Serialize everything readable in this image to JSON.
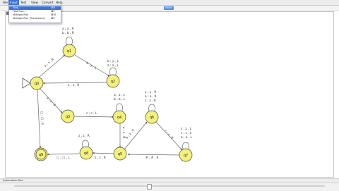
{
  "menubar": {
    "items": [
      "File",
      "Input",
      "Test",
      "View",
      "Convert",
      "Help"
    ]
  },
  "mode_badge": "Editor",
  "input_menu": {
    "items": [
      {
        "label": "Step...",
        "shortcut": "⌘R"
      },
      {
        "label": "Fast Run...",
        "shortcut": "⌘T"
      },
      {
        "label": "Multiple Run",
        "shortcut": "⌘M"
      },
      {
        "label": "Multiple Run (Transducer)",
        "shortcut": "⌘T"
      }
    ]
  },
  "automaton": {
    "states": [
      {
        "id": "q0",
        "label": "q0",
        "initial": true,
        "final": false
      },
      {
        "id": "q1",
        "label": "q1",
        "initial": false,
        "final": false
      },
      {
        "id": "q2",
        "label": "q2",
        "initial": false,
        "final": false
      },
      {
        "id": "q3",
        "label": "q3",
        "initial": false,
        "final": false
      },
      {
        "id": "q4",
        "label": "q4",
        "initial": false,
        "final": false
      },
      {
        "id": "q5",
        "label": "q5",
        "initial": false,
        "final": false
      },
      {
        "id": "q6",
        "label": "q6",
        "initial": false,
        "final": false
      },
      {
        "id": "q7",
        "label": "q7",
        "initial": false,
        "final": false
      },
      {
        "id": "q8",
        "label": "q8",
        "initial": false,
        "final": false
      },
      {
        "id": "q9",
        "label": "q9",
        "initial": false,
        "final": true
      }
    ],
    "transitions": [
      {
        "from": "q1",
        "to": "q1",
        "labels": [
          "a ; a , R",
          "b ; b , R"
        ]
      },
      {
        "from": "q0",
        "to": "q1",
        "labels": [
          "a ; x , R"
        ]
      },
      {
        "from": "q1",
        "to": "q2",
        "labels": [
          "b ; y , L"
        ]
      },
      {
        "from": "q2",
        "to": "q2",
        "labels": [
          "b ; y , L",
          "a ; a , L"
        ]
      },
      {
        "from": "q2",
        "to": "q0",
        "labels": [
          "x ; x , R"
        ]
      },
      {
        "from": "q0",
        "to": "q3",
        "labels": [
          "y ; y , R"
        ]
      },
      {
        "from": "q3",
        "to": "q4",
        "labels": [
          "c ; c , L"
        ]
      },
      {
        "from": "q4",
        "to": "q4",
        "labels": [
          "a ; a , L",
          "b ; b , L"
        ]
      },
      {
        "from": "q6",
        "to": "q6",
        "labels": [
          "y ; y , R",
          "a ; a , R",
          "z ; z , R"
        ]
      },
      {
        "from": "q6",
        "to": "q7",
        "labels": [
          "c ; z , R"
        ]
      },
      {
        "from": "q7",
        "to": "q7",
        "labels": [
          "z ; z , L",
          "c ; c , L",
          "a ; a , L"
        ]
      },
      {
        "from": "q7",
        "to": "q5",
        "labels": [
          "# ; # , R"
        ]
      },
      {
        "from": "q5",
        "to": "q6",
        "labels": [
          "b ; z , R"
        ]
      },
      {
        "from": "q4",
        "to": "q5",
        "labels": [
          "x ; x , R"
        ]
      },
      {
        "from": "q5",
        "to": "q8",
        "labels": [
          "z ; z , R"
        ]
      },
      {
        "from": "q8",
        "to": "q8",
        "labels": [
          "z ; z , R"
        ]
      },
      {
        "from": "q8",
        "to": "q9",
        "labels": [
          "□ ; □ , L"
        ]
      },
      {
        "from": "q0",
        "to": "q9",
        "labels": [
          "□ ; □ , S"
        ]
      }
    ]
  },
  "status": {
    "text": "Automaton Size"
  },
  "colors": {
    "state_fill": "#f4f17a",
    "state_stroke": "#4a4a4a",
    "menu_highlight": "#3b73d4"
  }
}
